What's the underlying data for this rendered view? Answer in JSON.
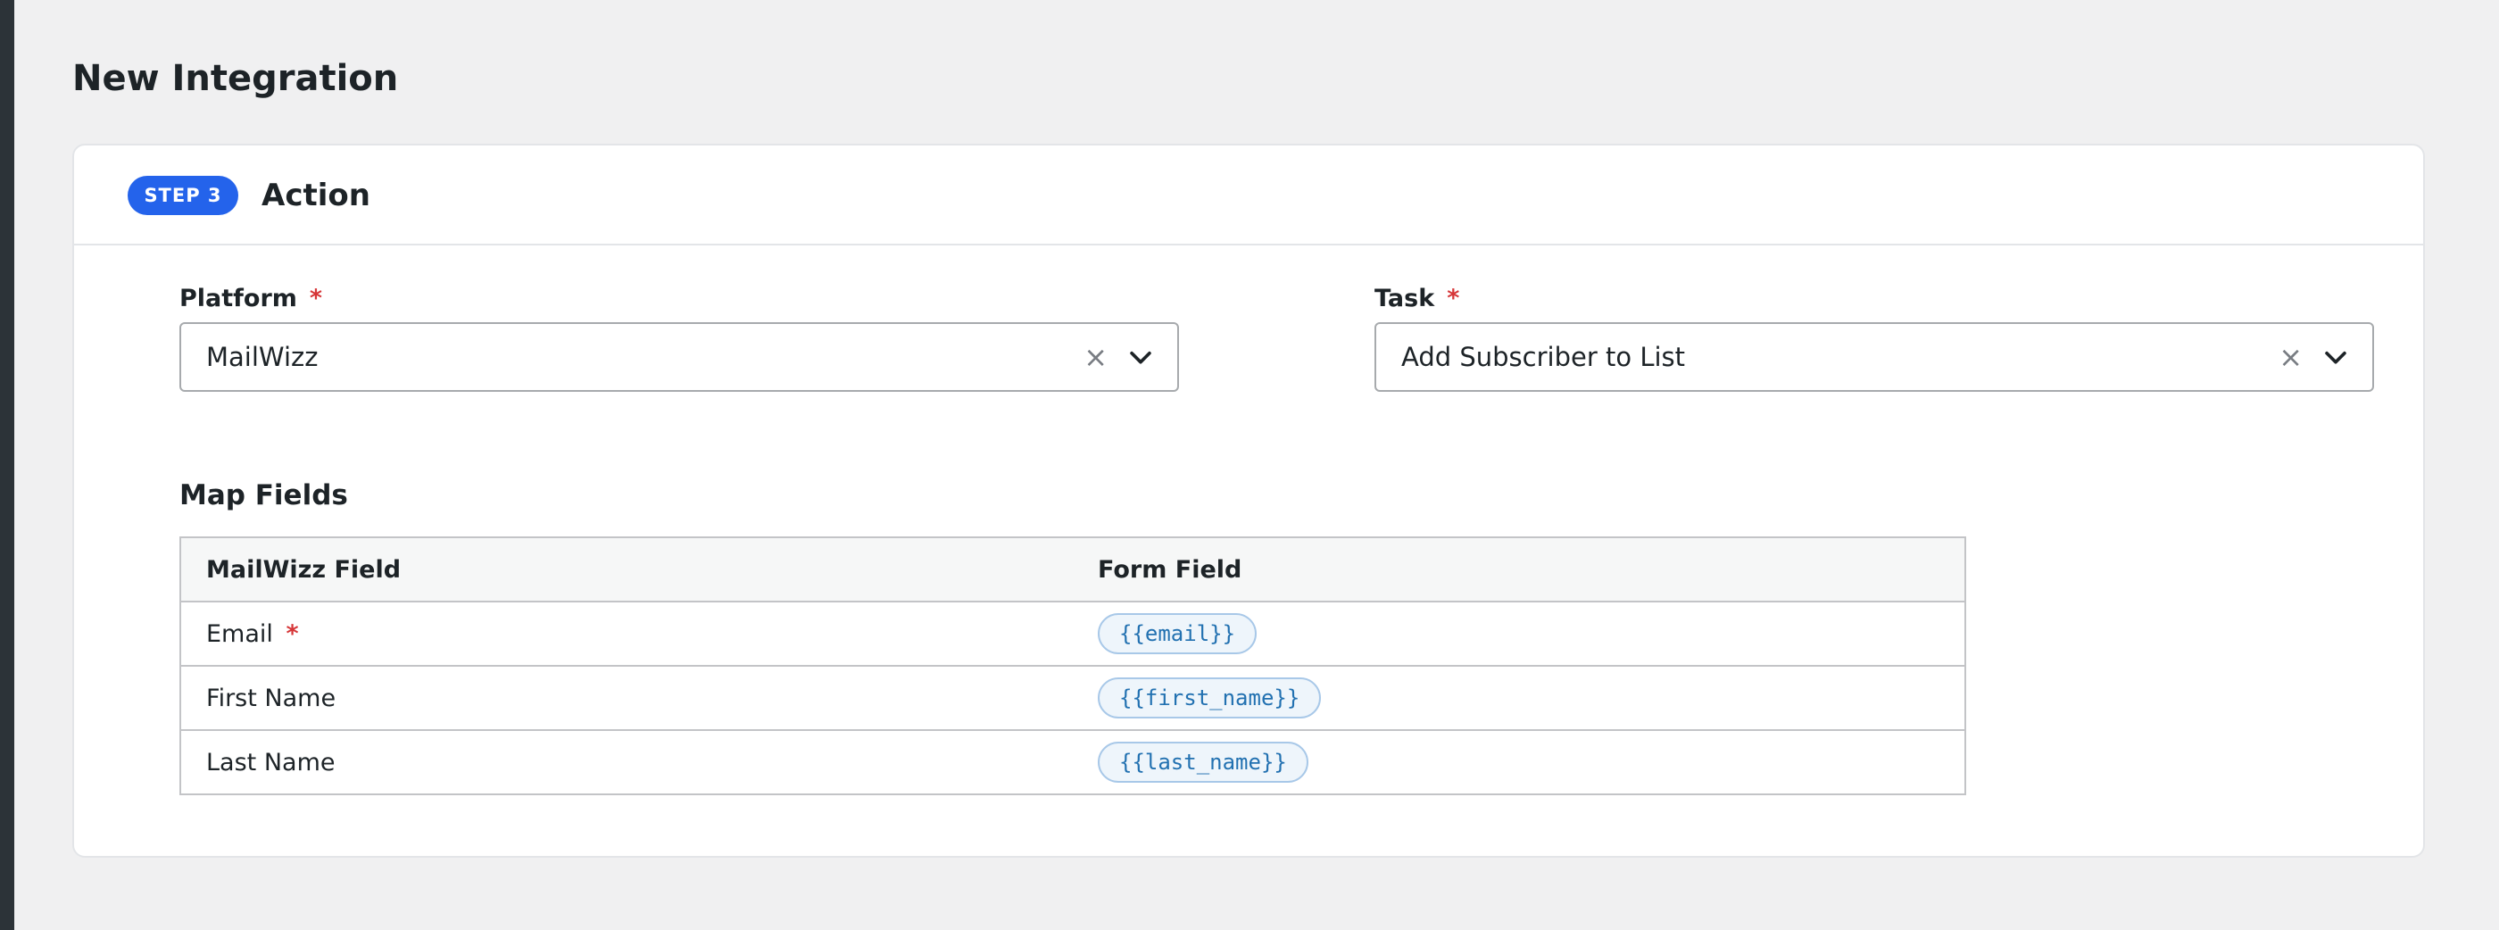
{
  "page": {
    "title": "New Integration"
  },
  "step": {
    "badge": "STEP 3",
    "title": "Action"
  },
  "platform": {
    "label": "Platform",
    "required_mark": "*",
    "value": "MailWizz",
    "clear": "×"
  },
  "task": {
    "label": "Task",
    "required_mark": "*",
    "value": "Add Subscriber to List",
    "clear": "×"
  },
  "map_fields": {
    "title": "Map Fields",
    "headers": [
      "MailWizz Field",
      "Form Field"
    ],
    "rows": [
      {
        "field": "Email",
        "required_mark": "*",
        "token": "{{email}}"
      },
      {
        "field": "First Name",
        "required_mark": "",
        "token": "{{first_name}}"
      },
      {
        "field": "Last Name",
        "required_mark": "",
        "token": "{{last_name}}"
      }
    ]
  },
  "colors": {
    "accent": "#2463eb",
    "required": "#d63638",
    "token_text": "#2271b1"
  },
  "icons": {
    "clear": "close-icon",
    "dropdown": "chevron-down-icon"
  }
}
